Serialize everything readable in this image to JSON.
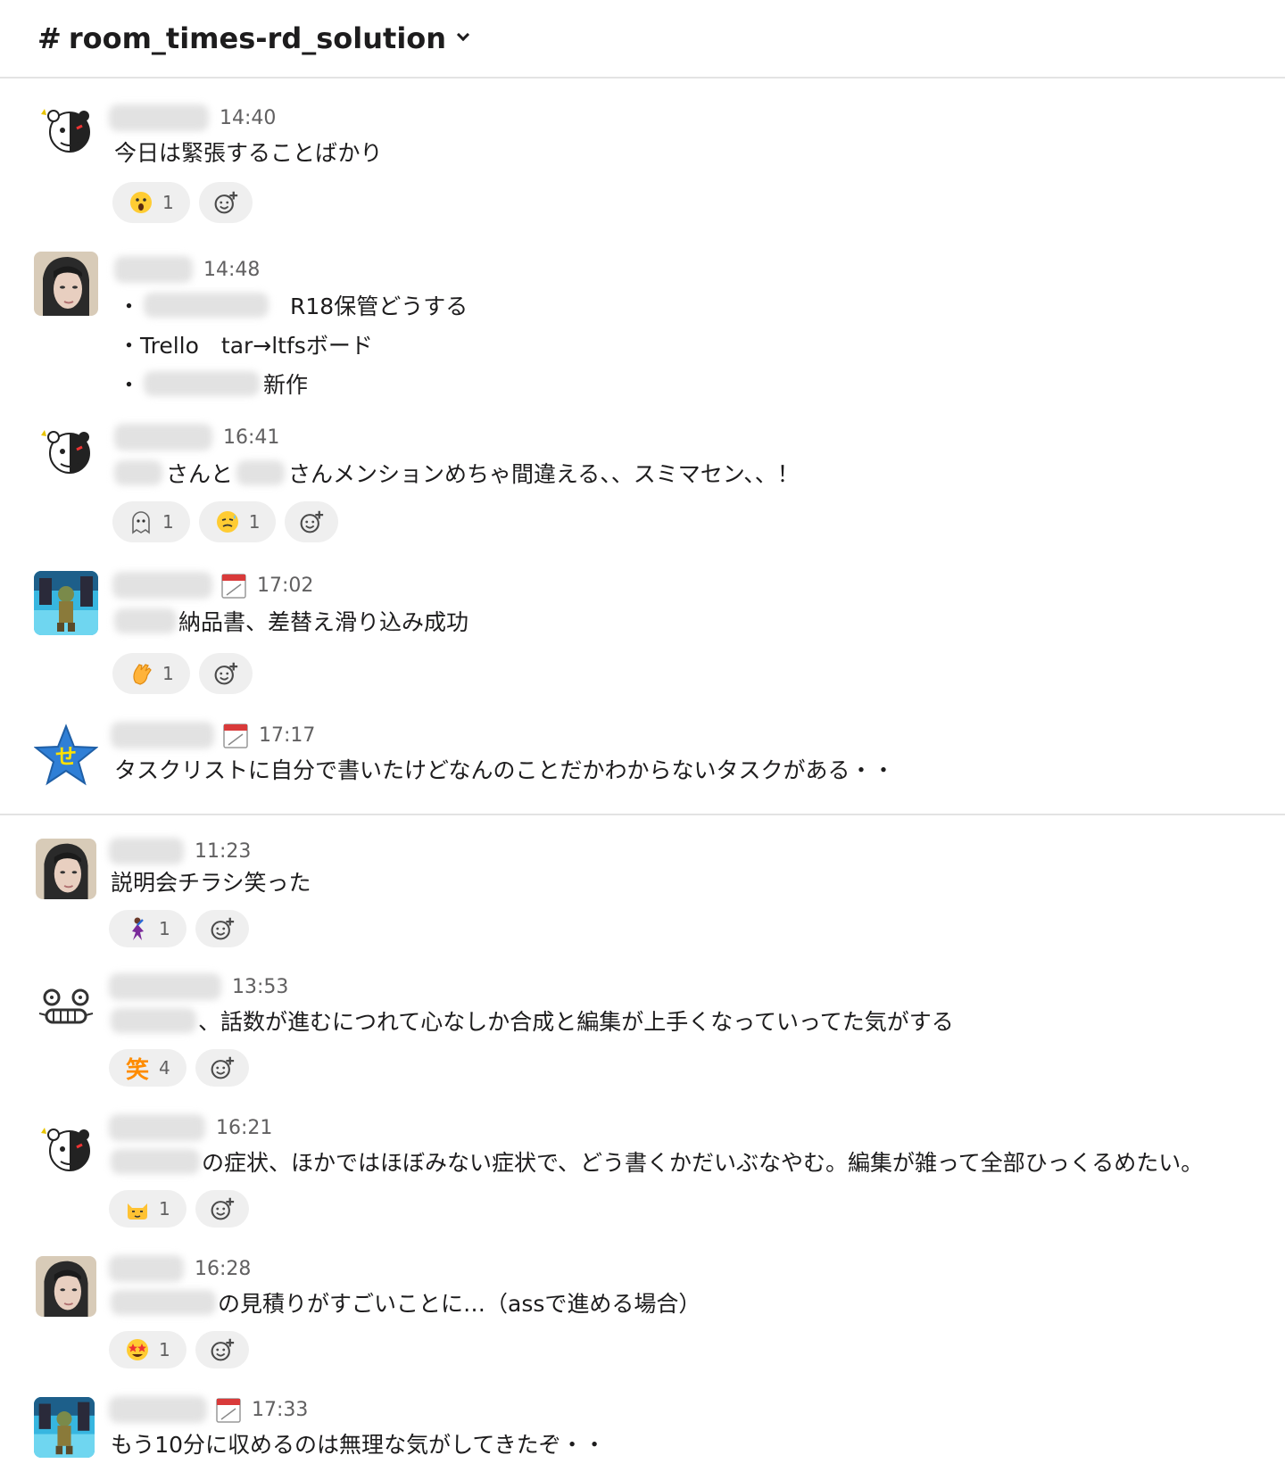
{
  "channel": {
    "hash": "#",
    "name": "room_times-rd_solution"
  },
  "messages": [
    {
      "time": "14:40",
      "lines": [
        "今日は緊張することばかり"
      ],
      "reactions": [
        {
          "emoji": "astonished-face",
          "count": "1"
        }
      ]
    },
    {
      "time": "14:48",
      "lines": [
        "R18保管どうする",
        "・Trello　tar→ltfsボード",
        "新作"
      ],
      "bullet": "・"
    },
    {
      "time": "16:41",
      "parts": [
        "さんと",
        "さんメンションめちゃ間違える、、スミマセン、、！"
      ],
      "reactions": [
        {
          "emoji": "ghost-face",
          "count": "1"
        },
        {
          "emoji": "sweat-smile-face",
          "count": "1"
        }
      ]
    },
    {
      "time": "17:02",
      "lines": [
        "納品書、差替え滑り込み成功"
      ],
      "reactions": [
        {
          "emoji": "clap-hands",
          "count": "1"
        }
      ]
    },
    {
      "time": "17:17",
      "lines": [
        "タスクリストに自分で書いたけどなんのことだかわからないタスクがある・・"
      ]
    },
    {
      "time": "11:23",
      "lines": [
        "説明会チラシ笑った"
      ],
      "reactions": [
        {
          "emoji": "dancer",
          "count": "1"
        }
      ]
    },
    {
      "time": "13:53",
      "lines": [
        "、話数が進むにつれて心なしか合成と編集が上手くなっていってた気がする"
      ],
      "reactions": [
        {
          "emoji": "warai-kanji",
          "label": "笑",
          "count": "4"
        }
      ]
    },
    {
      "time": "16:21",
      "lines": [
        "の症状、ほかではほぼみない症状で、どう書くかだいぶなやむ。編集が雑って全部ひっくるめたい。"
      ],
      "reactions": [
        {
          "emoji": "cat-face",
          "count": "1"
        }
      ]
    },
    {
      "time": "16:28",
      "lines": [
        "の見積りがすごいことに…（assで進める場合）"
      ],
      "reactions": [
        {
          "emoji": "star-eyes-face",
          "count": "1"
        }
      ]
    },
    {
      "time": "17:33",
      "lines": [
        "もう10分に収めるのは無理な気がしてきたぞ・・"
      ]
    }
  ],
  "colors": {
    "accent": "#1d1c1d",
    "muted": "#616061",
    "reaction_bg": "#efefef",
    "divider": "#e3e3e3"
  }
}
